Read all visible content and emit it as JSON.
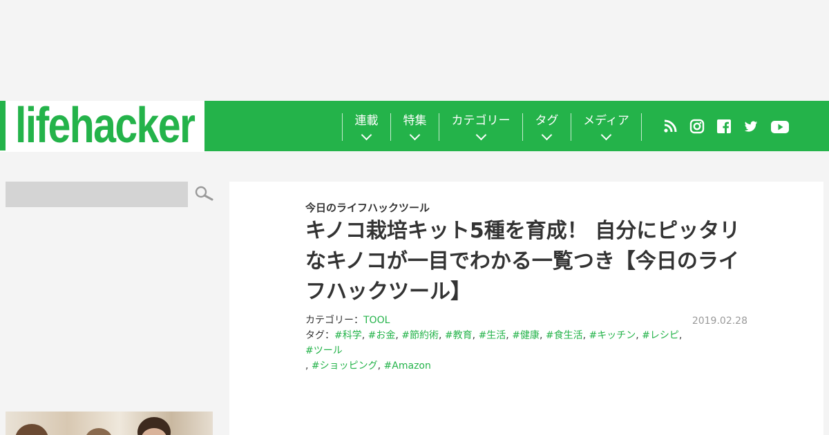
{
  "logo": {
    "text": "lifehacker"
  },
  "nav": {
    "items": [
      {
        "label": "連載"
      },
      {
        "label": "特集"
      },
      {
        "label": "カテゴリー"
      },
      {
        "label": "タグ"
      },
      {
        "label": "メディア"
      }
    ],
    "social": [
      "rss-icon",
      "instagram-icon",
      "facebook-icon",
      "twitter-icon",
      "youtube-icon"
    ]
  },
  "colors": {
    "brand": "#24b34a",
    "background": "#f4f4f4",
    "text": "#333333",
    "date": "#999999"
  },
  "search": {
    "placeholder": ""
  },
  "article": {
    "kicker": "今日のライフハックツール",
    "title": "キノコ栽培キット5種を育成！ 自分にピッタリなキノコが一目でわかる一覧つき【今日のライフハックツール】",
    "category_label": "カテゴリー：",
    "category": "TOOL",
    "tag_label": "タグ：",
    "tags": [
      "#科学",
      "#お金",
      "#節約術",
      "#教育",
      "#生活",
      "#健康",
      "#食生活",
      "#キッチン",
      "#レシピ",
      "#ツール",
      "#ショッピング",
      "#Amazon"
    ],
    "date": "2019.02.28"
  }
}
